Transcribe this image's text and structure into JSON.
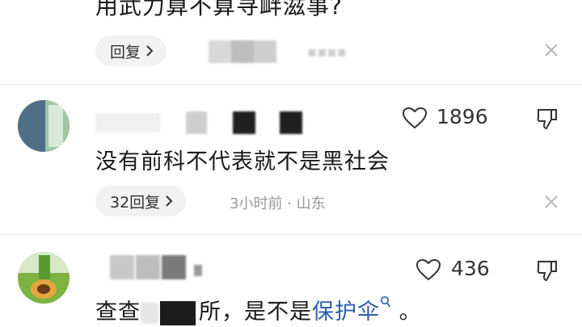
{
  "comments": [
    {
      "text": "用武力算不算寻衅滋事?",
      "reply_label": "回复",
      "meta": "",
      "likes": ""
    },
    {
      "text": "没有前科不代表就不是黑社会",
      "reply_label": "32回复",
      "meta": "3小时前 · 山东",
      "likes": "1896"
    },
    {
      "text_prefix": "查查",
      "text_mid": "所",
      "text_sep": "，是不是",
      "text_link": "保护伞",
      "text_end": " 。",
      "likes": "436"
    }
  ],
  "colors": {
    "link": "#2c5ea8",
    "pill_bg": "#f2f2f3",
    "meta": "#9a9a9a"
  },
  "icons": [
    "heart-icon",
    "dislike-icon",
    "close-icon",
    "chevron-right-icon",
    "search-icon"
  ]
}
